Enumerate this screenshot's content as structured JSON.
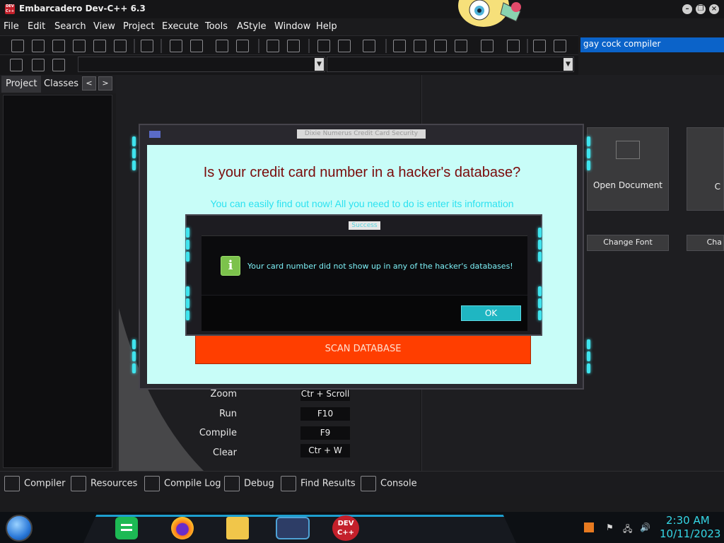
{
  "window": {
    "title": "Embarcadero Dev-C++ 6.3",
    "app_icon_text": "DEV C++",
    "controls": [
      "minimize",
      "restore",
      "close"
    ]
  },
  "menu": [
    "File",
    "Edit",
    "Search",
    "View",
    "Project",
    "Execute",
    "Tools",
    "AStyle",
    "Window",
    "Help"
  ],
  "search": {
    "value": "gay cock compiler"
  },
  "left_panel": {
    "tabs": [
      "Project",
      "Classes"
    ],
    "nav_prev": "<",
    "nav_next": ">"
  },
  "welcome": {
    "tiles": [
      {
        "label": "Open Document"
      },
      {
        "label": "C"
      }
    ],
    "buttons": [
      "Change Font",
      "Cha"
    ],
    "shortcuts": [
      {
        "action": "Zoom",
        "keys": "Ctr + Scroll"
      },
      {
        "action": "Run",
        "keys": "F10"
      },
      {
        "action": "Compile",
        "keys": "F9"
      },
      {
        "action": "Clear",
        "keys": "Ctr + W"
      }
    ]
  },
  "scam_app": {
    "title": "Dixie Numerus Credit Card Security",
    "headline": "Is your credit card number in a hacker's database?",
    "subline": "You can easily find out now! All you need to do is enter its information",
    "scan_button": "SCAN DATABASE"
  },
  "success_dialog": {
    "title": "Success",
    "message": "Your card number did not show up in any of the hacker's databases!",
    "ok_button": "OK"
  },
  "bottom_tabs": [
    "Compiler",
    "Resources",
    "Compile Log",
    "Debug",
    "Find Results",
    "Console"
  ],
  "taskbar": {
    "apps": [
      "start",
      "notes",
      "firefox",
      "file-explorer",
      "window-app",
      "dev-cpp"
    ],
    "devcpp_label": "DEV C++",
    "clock": {
      "time": "2:30 AM",
      "date": "10/11/2023"
    }
  },
  "colors": {
    "accent_cyan": "#3fe4ee",
    "scan_button": "#ff3e00",
    "dialog_bg": "#c8fdf8",
    "headline": "#7a0a0a",
    "search_highlight": "#0b63c9"
  }
}
